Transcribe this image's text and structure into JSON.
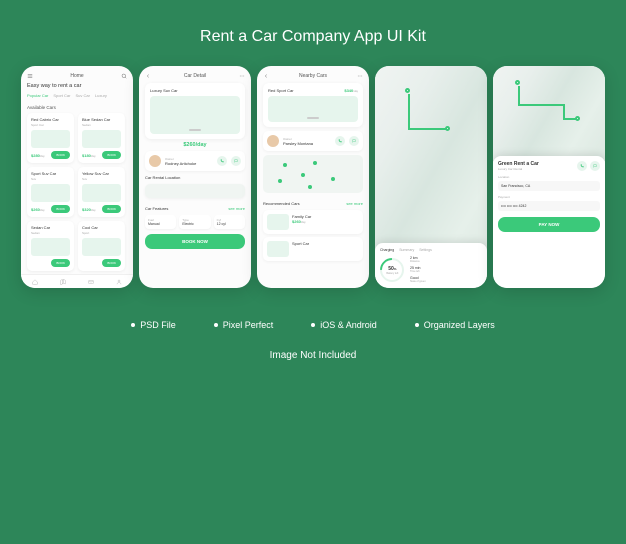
{
  "title": "Rent a Car Company App UI Kit",
  "features": [
    "PSD File",
    "Pixel Perfect",
    "iOS & Android",
    "Organized Layers"
  ],
  "footer": "Image Not Included",
  "colors": {
    "accent": "#3bc97a",
    "bg": "#2d8659"
  },
  "screen1": {
    "title": "Home",
    "headline": "Easy way to rent a car",
    "tabs": [
      "Popular Car",
      "Sport Car",
      "Suv Car",
      "Luxury"
    ],
    "section": "Available Cars",
    "cars": [
      {
        "name": "Red Cabrio Car",
        "sub": "Sport Car",
        "price": "$280",
        "unit": "/day"
      },
      {
        "name": "Blue Sedan Car",
        "sub": "Sedan",
        "price": "$180",
        "unit": "/day"
      },
      {
        "name": "Sport Suv Car",
        "sub": "Suv",
        "price": "$260",
        "unit": "/day"
      },
      {
        "name": "Yellow Suv Car",
        "sub": "Suv",
        "price": "$320",
        "unit": "/day"
      },
      {
        "name": "Sedan Car",
        "sub": "Sedan",
        "price": "",
        "unit": ""
      },
      {
        "name": "Cool Car",
        "sub": "Sport",
        "price": "",
        "unit": ""
      }
    ],
    "book": "BOOK"
  },
  "screen2": {
    "title": "Car Detail",
    "car": "Luxury Suv Car",
    "price": "$260",
    "unit": "/day",
    "ownerLabel": "Owner",
    "ownerName": "Rodney Artichoke",
    "locationTitle": "Car Rental Location",
    "featuresTitle": "Car Features",
    "seeMore": "see more",
    "feats": [
      {
        "l": "Fuel",
        "v": "Manual"
      },
      {
        "l": "Type",
        "v": "Electric"
      },
      {
        "l": "Cyl",
        "v": "12 cyl"
      }
    ],
    "cta": "BOOK NOW"
  },
  "screen3": {
    "title": "Nearby Cars",
    "topCar": {
      "name": "Red Sport Car",
      "price": "$340",
      "unit": "/day"
    },
    "ownerLabel": "Owner",
    "ownerName": "Parsley Montana",
    "mapDots": 6,
    "recTitle": "Recommended Cars",
    "seeMore": "see more",
    "rec": [
      {
        "name": "Family Car",
        "price": "$260",
        "unit": "/day"
      },
      {
        "name": "Sport Car",
        "price": "",
        "unit": ""
      }
    ]
  },
  "screen4": {
    "tabs": [
      "Charging",
      "Summary",
      "Settings"
    ],
    "battery": {
      "value": "50",
      "unit": "%",
      "label": "Battery left"
    },
    "stats": [
      {
        "v": "2 km",
        "l": "Distance"
      },
      {
        "v": "25 min",
        "l": "Time left"
      },
      {
        "v": "Good",
        "l": "State of green"
      }
    ]
  },
  "screen5": {
    "company": "Green Rent a Car",
    "subtitle": "Luxury Car Rental",
    "locLabel": "Location",
    "locValue": "San Francisco, CA",
    "payLabel": "Payment",
    "payValue": "•••• •••• •••• 4242",
    "cta": "PAY NOW"
  }
}
